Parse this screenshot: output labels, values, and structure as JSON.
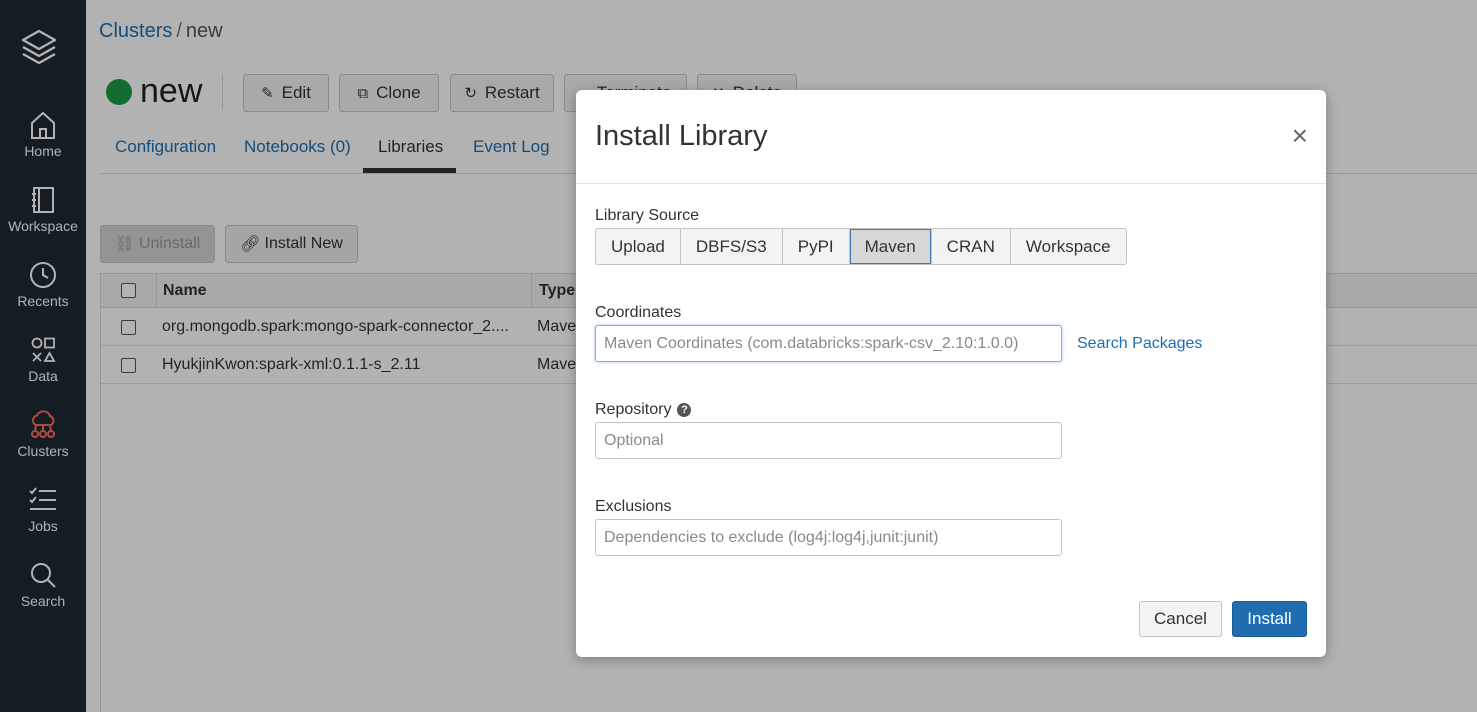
{
  "sidebar": {
    "items": [
      {
        "label": "Home",
        "icon": "home-icon"
      },
      {
        "label": "Workspace",
        "icon": "workspace-icon"
      },
      {
        "label": "Recents",
        "icon": "clock-icon"
      },
      {
        "label": "Data",
        "icon": "data-shapes-icon"
      },
      {
        "label": "Clusters",
        "icon": "cloud-cluster-icon",
        "active": true
      },
      {
        "label": "Jobs",
        "icon": "jobs-list-icon"
      },
      {
        "label": "Search",
        "icon": "search-icon"
      }
    ]
  },
  "breadcrumb": {
    "parent": "Clusters",
    "separator": "/",
    "current": "new"
  },
  "cluster": {
    "name": "new",
    "status_color": "#1e9b45"
  },
  "actions": {
    "edit": "Edit",
    "clone": "Clone",
    "restart": "Restart",
    "terminate": "Terminate",
    "delete": "Delete"
  },
  "tabs": [
    "Configuration",
    "Notebooks (0)",
    "Libraries",
    "Event Log"
  ],
  "active_tab": "Libraries",
  "library_actions": {
    "uninstall": "Uninstall",
    "install_new": "Install New"
  },
  "table": {
    "headers": {
      "name": "Name",
      "type": "Type"
    },
    "rows": [
      {
        "name": "org.mongodb.spark:mongo-spark-connector_2....",
        "type": "Maven"
      },
      {
        "name": "HyukjinKwon:spark-xml:0.1.1-s_2.11",
        "type": "Maven"
      }
    ]
  },
  "modal": {
    "title": "Install Library",
    "close": "×",
    "source_label": "Library Source",
    "sources": [
      "Upload",
      "DBFS/S3",
      "PyPI",
      "Maven",
      "CRAN",
      "Workspace"
    ],
    "selected_source": "Maven",
    "coordinates_label": "Coordinates",
    "coordinates_placeholder": "Maven Coordinates (com.databricks:spark-csv_2.10:1.0.0)",
    "search_packages": "Search Packages",
    "repository_label": "Repository",
    "repository_placeholder": "Optional",
    "exclusions_label": "Exclusions",
    "exclusions_placeholder": "Dependencies to exclude (log4j:log4j,junit:junit)",
    "cancel": "Cancel",
    "install": "Install"
  },
  "colors": {
    "sidebar": "#1c2a33",
    "accent": "#1f6db0",
    "active_nav": "#ff6b5c",
    "status": "#1e9b45"
  }
}
